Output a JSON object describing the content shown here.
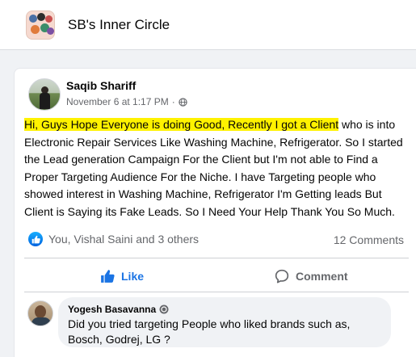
{
  "group": {
    "name": "SB's Inner Circle"
  },
  "post": {
    "author": "Saqib Shariff",
    "timestamp": "November 6 at 1:17 PM",
    "separator": "·",
    "audience_icon": "globe-icon",
    "text_highlighted": "Hi, Guys Hope Everyone is doing Good, Recently I got a Client",
    "text_rest": " who is into Electronic Repair Services Like Washing Machine, Refrigerator. So I started the Lead generation Campaign For the Client but I'm not able to Find a Proper Targeting Audience For the Niche. I have Targeting people who showed interest in Washing Machine, Refrigerator I'm Getting leads But Client is Saying its Fake Leads. So I Need Your Help Thank You So Much.",
    "highlight_color": "#fff200",
    "reactions_text": "You, Vishal Saini and 3 others",
    "comments_count": "12 Comments"
  },
  "actions": {
    "like_label": "Like",
    "comment_label": "Comment",
    "like_color": "#1b74e4"
  },
  "comment": {
    "author": "Yogesh Basavanna",
    "badge_icon": "top-contributor-badge-icon",
    "text": "Did you tried targeting People who liked brands such as, Bosch, Godrej, LG ?"
  }
}
